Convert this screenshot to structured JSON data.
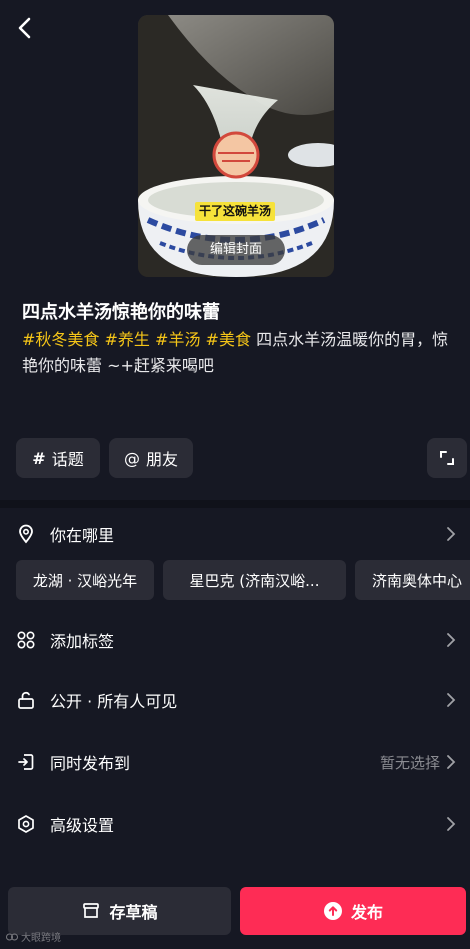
{
  "cover": {
    "caption": "干了这碗羊汤",
    "edit_label": "编辑封面"
  },
  "post": {
    "title": "四点水羊汤惊艳你的味蕾",
    "tags": [
      "#秋冬美食",
      "#养生",
      "#羊汤",
      "#美食"
    ],
    "description": "四点水羊汤温暖你的胃，惊艳你的味蕾 ~+赶紧来喝吧"
  },
  "chips": {
    "topic": "话题",
    "friends": "朋友"
  },
  "location": {
    "label": "你在哪里",
    "suggestions": [
      "龙湖 · 汉峪光年",
      "星巴克 (济南汉峪...",
      "济南奥体中心"
    ]
  },
  "settings": {
    "add_tag": "添加标签",
    "visibility": "公开 · 所有人可见",
    "sync": "同时发布到",
    "sync_value": "暂无选择",
    "advanced": "高级设置"
  },
  "actions": {
    "draft": "存草稿",
    "publish": "发布"
  },
  "watermark": "大眼跨境",
  "colors": {
    "background": "#161823",
    "tag": "#f5c518",
    "publish": "#fe2c55",
    "chip": "#2b2c36"
  },
  "icons": {
    "back": "chevron-left",
    "location": "map-pin",
    "add_tag": "grid-four",
    "visibility": "unlock",
    "sync": "share-out",
    "advanced": "hexagon-settings"
  }
}
